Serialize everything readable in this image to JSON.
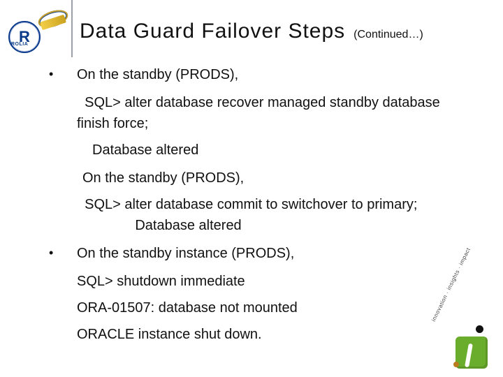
{
  "logo": {
    "rolia_initial": "R",
    "rolia_word": "ROLIA"
  },
  "title": "Data Guard Failover Steps",
  "subtitle": "(Continued…)",
  "bullet1": {
    "heading": "On the standby (PRODS),",
    "cmd1_lead": "SQL>",
    "cmd1_rest": " alter database recover managed standby database finish force;",
    "resp1": "Database altered",
    "heading2": "On the standby (PRODS),",
    "cmd2_lead": "SQL>",
    "cmd2_rest_a": " alter database commit to switchover to primary;",
    "resp2": "Database altered"
  },
  "bullet2": {
    "heading": "On the standby instance (PRODS),",
    "line1": "SQL> shutdown immediate",
    "line2": "ORA-01507: database not mounted",
    "line3": "ORACLE instance shut down."
  },
  "insight_logo": {
    "arc_text": "innovation · insights · impact"
  }
}
